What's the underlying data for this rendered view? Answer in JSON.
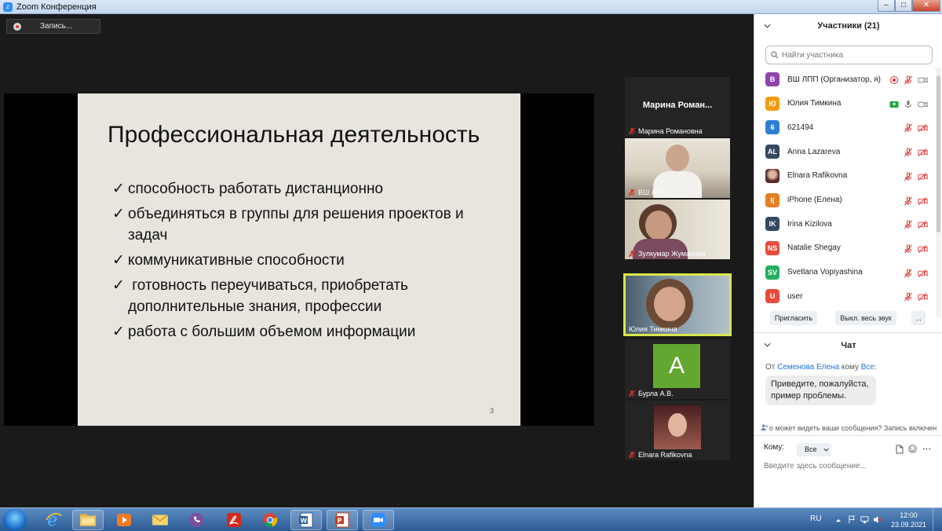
{
  "window": {
    "title": "Zoom Конференция",
    "min": "–",
    "max": "□",
    "close": "✕",
    "icon_glyph": "z"
  },
  "recording": {
    "label": "Запись..."
  },
  "slide": {
    "title": "Профессиональная деятельность",
    "bullets": [
      "способность работать дистанционно",
      "объединяться в группы для решения проектов и задач",
      "коммуникативные способности",
      " готовность переучиваться, приобретать дополнительные знания, профессии",
      "работа с большим объемом информации"
    ],
    "check": "✓",
    "page_number": "3"
  },
  "gallery": [
    {
      "big_name": "Марина  Роман...",
      "name": "Марина Романовна",
      "muted": true
    },
    {
      "name": "ВШ ЛПП",
      "muted": true
    },
    {
      "name": "Зулкумар Жуманова",
      "muted": true
    },
    {
      "name": "Юлия Тимкина",
      "muted": false,
      "active": true
    },
    {
      "name": "Бурла А.В.",
      "muted": true,
      "avatar_letter": "A"
    },
    {
      "name": "Elnara Rafikovna",
      "muted": true
    }
  ],
  "participants": {
    "title": "Участники (21)",
    "search_placeholder": "Найти участника",
    "list": [
      {
        "initials": "В",
        "name": "ВШ ЛПП (Организатор, я)",
        "color": "#8e44ad",
        "recording": true,
        "mic": "muted",
        "video": "on"
      },
      {
        "initials": "Ю",
        "name": "Юлия Тимкина",
        "color": "#f39c12",
        "sharing": true,
        "mic": "on",
        "video": "on"
      },
      {
        "initials": "6",
        "name": "621494",
        "color": "#2d7fd6",
        "mic": "muted",
        "video": "off"
      },
      {
        "initials": "AL",
        "name": "Anna Lazareva",
        "color": "#34495e",
        "mic": "muted",
        "video": "off"
      },
      {
        "initials": "",
        "name": "Elnara Rafikovna",
        "color": "#a0505a",
        "photo": true,
        "mic": "muted",
        "video": "off"
      },
      {
        "initials": "I(",
        "name": "iPhone (Елена)",
        "color": "#e67e22",
        "mic": "muted",
        "video": "off"
      },
      {
        "initials": "IK",
        "name": "Irina Kizilova",
        "color": "#34495e",
        "mic": "muted",
        "video": "off"
      },
      {
        "initials": "NS",
        "name": "Natalie Shegay",
        "color": "#e74c3c",
        "mic": "muted",
        "video": "off"
      },
      {
        "initials": "SV",
        "name": "Svetlana Vopiyashina",
        "color": "#27ae60",
        "mic": "muted",
        "video": "off"
      },
      {
        "initials": "U",
        "name": "user",
        "color": "#e74c3c",
        "mic": "muted",
        "video": "off"
      }
    ],
    "invite": "Пригласить",
    "mute_all": "Выкл. весь звук",
    "more": "..."
  },
  "chat": {
    "title": "Чат",
    "from_prefix": "От",
    "from_name": "Семенова Елена",
    "to_word": "кому",
    "to_name": "Все:",
    "message": "Приведите, пожалуйста, пример проблемы.",
    "notice": "о может видеть ваши сообщения? Запись включен",
    "to_label": "Кому:",
    "to_value": "Все",
    "input_placeholder": "Введите здесь сообщение..."
  },
  "taskbar": {
    "apps": [
      "ie",
      "explorer",
      "media-player",
      "mail",
      "viber",
      "acrobat",
      "chrome",
      "word",
      "powerpoint",
      "zoom"
    ],
    "lang": "RU",
    "time": "12:00",
    "date": "23.09.2021"
  },
  "colors": {
    "accent": "#2d8cff",
    "mute_red": "#e02f2f",
    "active_border": "#d9e64a"
  }
}
